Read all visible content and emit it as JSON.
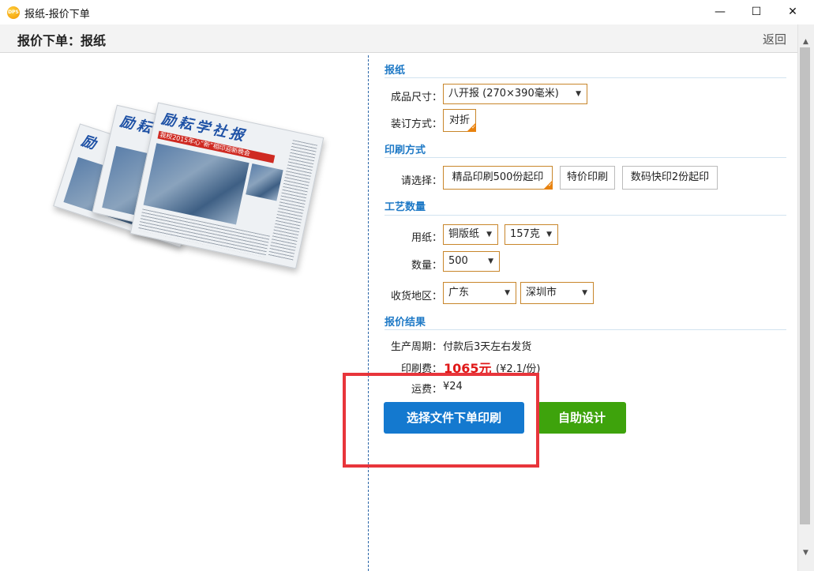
{
  "window": {
    "title": "报纸-报价下单",
    "app_icon_text": "DPS",
    "minimize_glyph": "—",
    "maximize_glyph": "☐",
    "close_glyph": "✕"
  },
  "header": {
    "title": "报价下单：报纸",
    "back_label": "返回"
  },
  "product_image": {
    "masthead": "励耘学社报",
    "headline": "我校2015年心“新”相印迎新晚会",
    "icon": "newspaper-image"
  },
  "sections": {
    "newspaper": {
      "title": "报纸",
      "size_label": "成品尺寸：",
      "size_value": "八开报 (270×390毫米)",
      "binding_label": "装订方式：",
      "binding_value": "对折"
    },
    "print_method": {
      "title": "印刷方式",
      "choose_label": "请选择：",
      "options": [
        "精品印刷500份起印",
        "特价印刷",
        "数码快印2份起印"
      ],
      "selected_index": 0
    },
    "craft_quantity": {
      "title": "工艺数量",
      "paper_label": "用纸：",
      "paper_value": "铜版纸",
      "weight_value": "157克",
      "quantity_label": "数量：",
      "quantity_value": "500",
      "region_label": "收货地区：",
      "province_value": "广东",
      "city_value": "深圳市"
    },
    "quote_result": {
      "title": "报价结果",
      "cycle_label": "生产周期：",
      "cycle_value": "付款后3天左右发货",
      "print_fee_label": "印刷费：",
      "print_fee_value": "1065元",
      "print_fee_unit": "(¥2.1/份)",
      "shipping_label": "运费：",
      "shipping_value": "¥24"
    }
  },
  "actions": {
    "select_file_label": "选择文件下单印刷",
    "self_design_label": "自助设计"
  },
  "colors": {
    "accent_blue": "#1479cf",
    "section_blue": "#1e79c6",
    "action_green": "#3ea30c",
    "price_red": "#e01818",
    "highlight_red": "#e8353b",
    "select_border": "#c8862b"
  }
}
